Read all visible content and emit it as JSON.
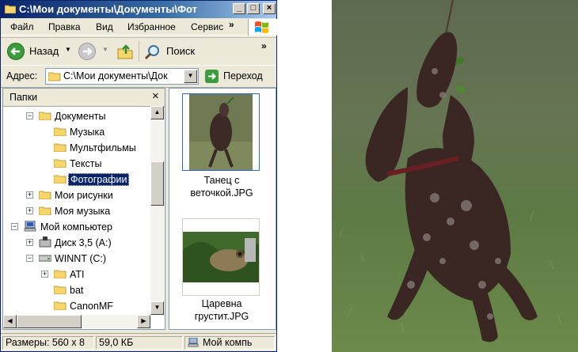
{
  "window": {
    "title": "C:\\Мои документы\\Документы\\Фот",
    "caption_buttons": [
      "_",
      "□",
      "×"
    ]
  },
  "menu": {
    "items": [
      "Файл",
      "Правка",
      "Вид",
      "Избранное",
      "Сервис"
    ],
    "overflow": "»"
  },
  "toolbar": {
    "back_label": "Назад",
    "search_label": "Поиск",
    "overflow": "»"
  },
  "address": {
    "label": "Адрес:",
    "value": "C:\\Мои документы\\Док",
    "go_label": "Переход"
  },
  "folders_pane": {
    "title": "Папки",
    "close": "×",
    "items": [
      {
        "label": "Документы",
        "expander": "−",
        "icon": "folder-open-icon"
      },
      {
        "label": "Музыка",
        "expander": "",
        "icon": "folder-icon"
      },
      {
        "label": "Мультфильмы",
        "expander": "",
        "icon": "folder-icon"
      },
      {
        "label": "Тексты",
        "expander": "",
        "icon": "folder-icon"
      },
      {
        "label": "Фотографии",
        "expander": "",
        "icon": "folder-open-icon",
        "selected": true
      },
      {
        "label": "Мои рисунки",
        "expander": "+",
        "icon": "folder-icon"
      },
      {
        "label": "Моя музыка",
        "expander": "+",
        "icon": "folder-icon"
      },
      {
        "label": "Мой компьютер",
        "expander": "−",
        "icon": "computer-icon"
      },
      {
        "label": "Диск 3,5 (A:)",
        "expander": "+",
        "icon": "floppy-icon"
      },
      {
        "label": "WINNT (C:)",
        "expander": "−",
        "icon": "drive-icon"
      },
      {
        "label": "ATI",
        "expander": "+",
        "icon": "folder-icon"
      },
      {
        "label": "bat",
        "expander": "",
        "icon": "folder-icon"
      },
      {
        "label": "CanonMF",
        "expander": "",
        "icon": "folder-icon"
      }
    ]
  },
  "files": [
    {
      "name_line1": "Танец с",
      "name_line2": "веточкой.JPG",
      "selected": true
    },
    {
      "name_line1": "Царевна",
      "name_line2": "грустит.JPG",
      "selected": false
    }
  ],
  "statusbar": {
    "dimensions": "Размеры: 560 x 8",
    "size": "59,0 КБ",
    "zone": "Мой компь"
  },
  "colors": {
    "title_bar": "#0a246a",
    "selection": "#316ac5",
    "window_face": "#ece9d8"
  }
}
